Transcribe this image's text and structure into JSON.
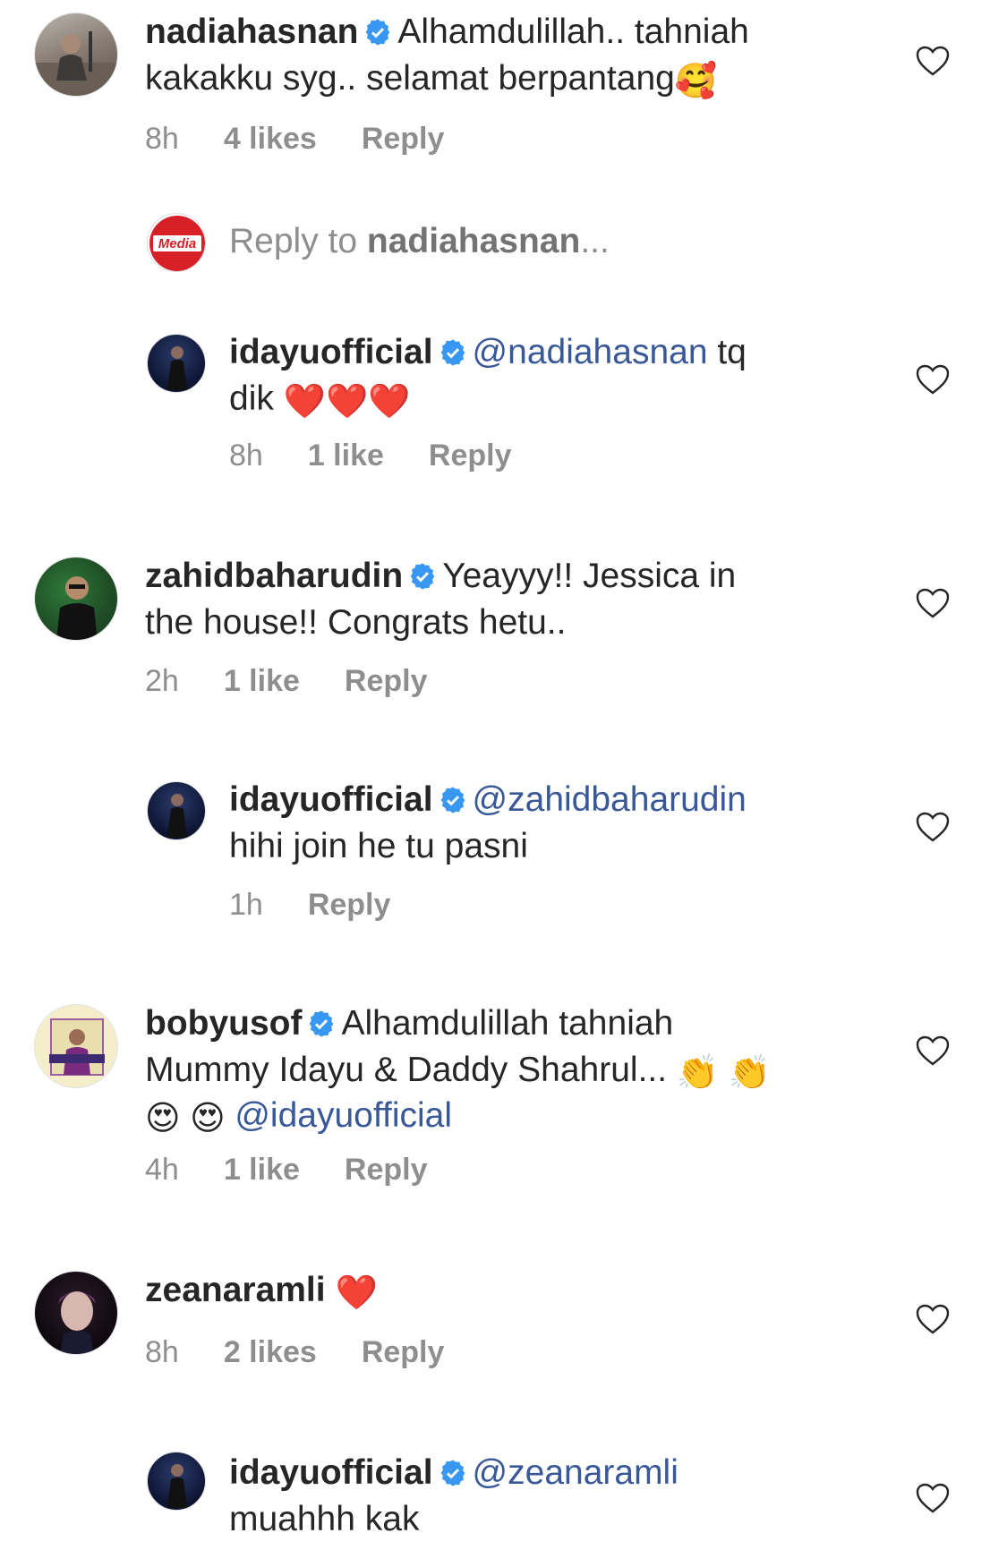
{
  "reply_prompt": {
    "prefix": "Reply to ",
    "username": "nadiahasnan",
    "suffix": "..."
  },
  "comments": [
    {
      "username": "nadiahasnan",
      "text": "Alhamdulillah.. tahniah kakakku syg.. selamat berpantang",
      "emoji": "🥰",
      "time": "8h",
      "likes": "4 likes",
      "reply": "Reply"
    },
    {
      "username": "idayuofficial",
      "mention": "@nadiahasnan",
      "text_line1_tail": " tq",
      "text_line2": "dik ",
      "emoji": "❤️❤️❤️",
      "time": "8h",
      "likes": "1 like",
      "reply": "Reply"
    },
    {
      "username": "zahidbaharudin",
      "text": "Yeayyy!! Jessica in",
      "text_line2": "the house!! Congrats hetu..",
      "time": "2h",
      "likes": "1 like",
      "reply": "Reply"
    },
    {
      "username": "idayuofficial",
      "mention": "@zahidbaharudin",
      "text_line2": "hihi join he tu pasni",
      "time": "1h",
      "reply": "Reply"
    },
    {
      "username": "bobyusof",
      "text": "Alhamdulillah tahniah",
      "text_line2": "Mummy Idayu & Daddy Shahrul... ",
      "emoji_line2": "👏 👏",
      "emoji_line3": "😍 😍 ",
      "mention": "@idayuofficial",
      "time": "4h",
      "likes": "1 like",
      "reply": "Reply"
    },
    {
      "username": "zeanaramli",
      "emoji": "❤️",
      "time": "8h",
      "likes": "2 likes",
      "reply": "Reply"
    },
    {
      "username": "idayuofficial",
      "mention": "@zeanaramli",
      "text_line2": "muahhh kak"
    }
  ],
  "reply_avatar_logo": "Media",
  "colors": {
    "mention": "#385898",
    "verified": "#3897f0",
    "meta": "#8e8e8e"
  }
}
